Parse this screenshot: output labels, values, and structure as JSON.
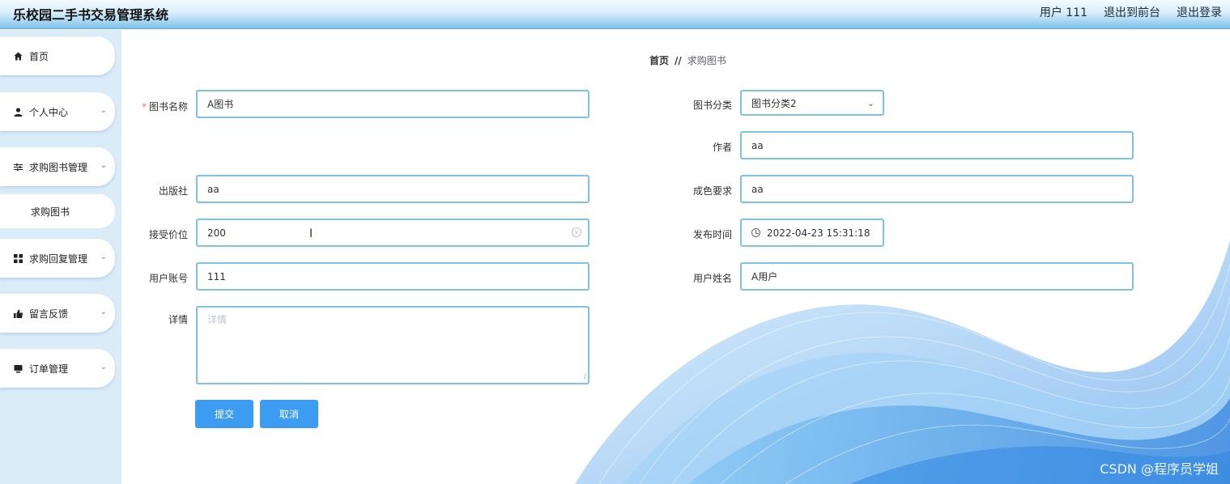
{
  "header": {
    "title": "乐校园二手书交易管理系统",
    "user": "用户 111",
    "to_front": "退出到前台",
    "logout": "退出登录"
  },
  "sidebar": {
    "items": [
      {
        "label": "首页",
        "icon": "home-icon"
      },
      {
        "label": "个人中心",
        "icon": "user-icon"
      },
      {
        "label": "求购图书管理",
        "icon": "sliders-icon"
      },
      {
        "label": "求购图书",
        "icon": ""
      },
      {
        "label": "求购回复管理",
        "icon": "grid-icon"
      },
      {
        "label": "留言反馈",
        "icon": "thumb-icon"
      },
      {
        "label": "订单管理",
        "icon": "monitor-icon"
      }
    ]
  },
  "breadcrumb": {
    "home": "首页",
    "sep": "//",
    "current": "求购图书"
  },
  "form": {
    "book_name": {
      "label": "图书名称",
      "value": "A图书"
    },
    "category": {
      "label": "图书分类",
      "value": "图书分类2"
    },
    "author": {
      "label": "作者",
      "value": "aa"
    },
    "publisher": {
      "label": "出版社",
      "value": "aa"
    },
    "condition": {
      "label": "成色要求",
      "value": "aa"
    },
    "price": {
      "label": "接受价位",
      "value": "200"
    },
    "publish_time": {
      "label": "发布时间",
      "value": "2022-04-23 15:31:18"
    },
    "account": {
      "label": "用户账号",
      "value": "111"
    },
    "username": {
      "label": "用户姓名",
      "value": "A用户"
    },
    "details": {
      "label": "详情",
      "placeholder": "详情"
    }
  },
  "buttons": {
    "submit": "提交",
    "cancel": "取消"
  },
  "watermark": "CSDN @程序员学姐",
  "colors": {
    "accent": "#3c9cf2",
    "input_border": "#7dc3e3",
    "sidebar_bg": "#d9ecf8",
    "required": "#f56c6c"
  }
}
